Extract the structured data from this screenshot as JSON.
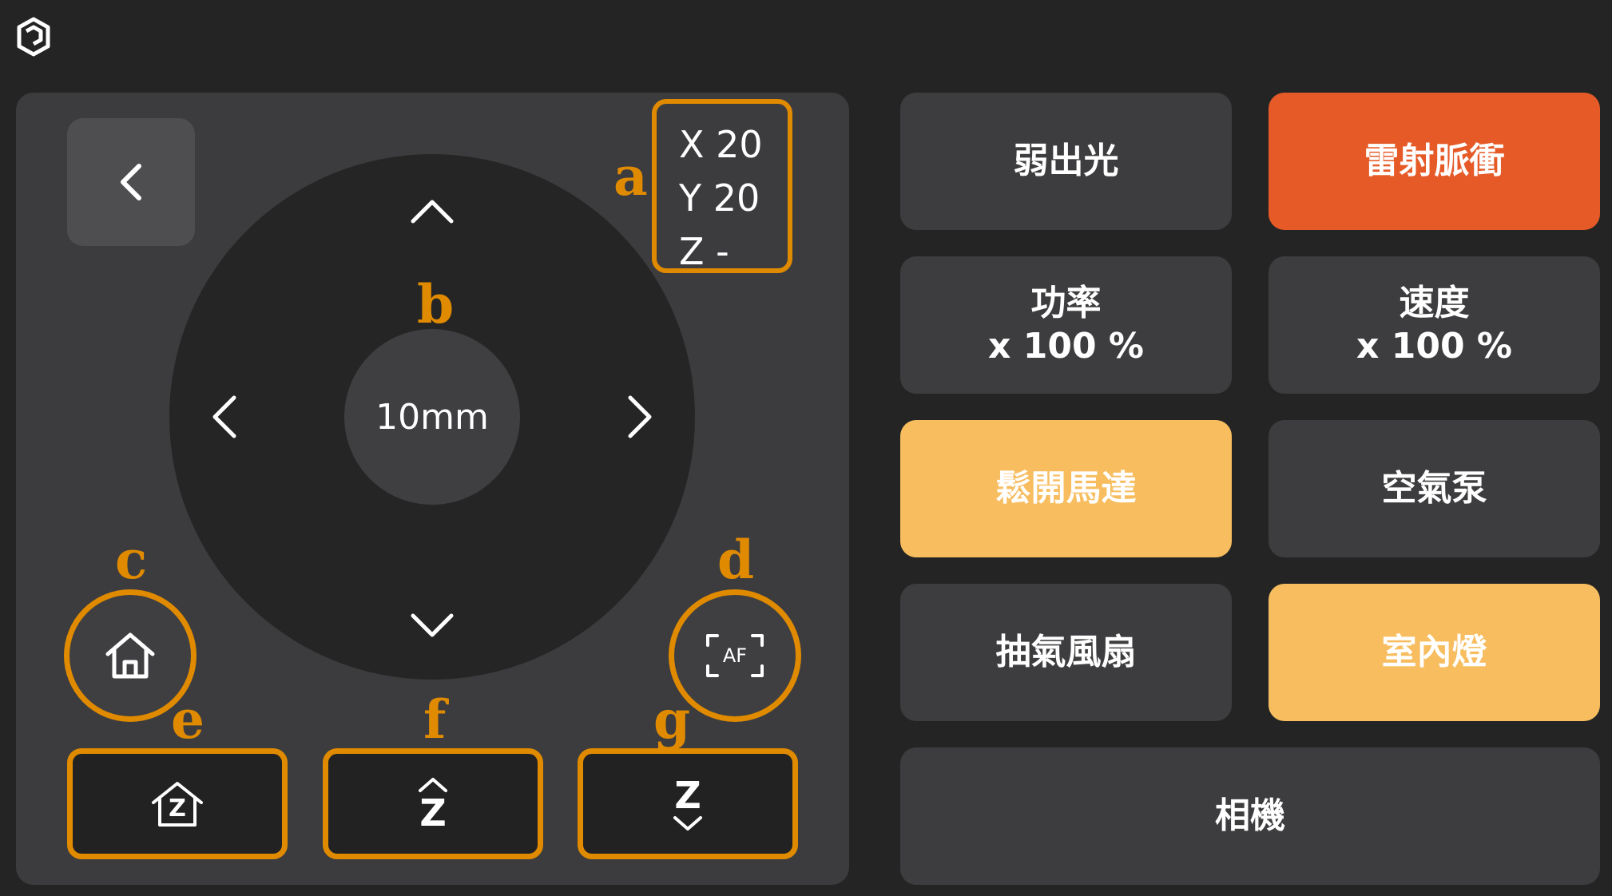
{
  "app": {
    "logo_icon": "app-logo-icon"
  },
  "jog_panel": {
    "back_icon": "chevron-left-icon",
    "position": {
      "x": "X 20",
      "y": "Y 20",
      "z": "Z -"
    },
    "step_label": "10mm",
    "arrows": [
      "chevron-up-icon",
      "chevron-down-icon",
      "chevron-left-icon",
      "chevron-right-icon"
    ],
    "home_icon": "home-icon",
    "autofocus_icon": "autofocus-af-icon",
    "autofocus_label": "AF",
    "z_home_label": "Z",
    "z_up_label": "Z",
    "z_down_label": "Z"
  },
  "markers": {
    "a": "a",
    "b": "b",
    "c": "c",
    "d": "d",
    "e": "e",
    "f": "f",
    "g": "g"
  },
  "functions": {
    "low_light": "弱出光",
    "laser_pulse": "雷射脈衝",
    "power_title": "功率",
    "power_value": "x 100 %",
    "speed_title": "速度",
    "speed_value": "x 100 %",
    "release_motor": "鬆開馬達",
    "air_pump": "空氣泵",
    "exhaust_fan": "抽氣風扇",
    "room_light": "室內燈",
    "camera": "相機"
  },
  "colors": {
    "background": "#242424",
    "panel": "#3c3c3e",
    "button": "#3d3d3f",
    "accent_red": "#e55a26",
    "accent_yellow": "#f7bd5f",
    "highlight": "#e08a00"
  }
}
